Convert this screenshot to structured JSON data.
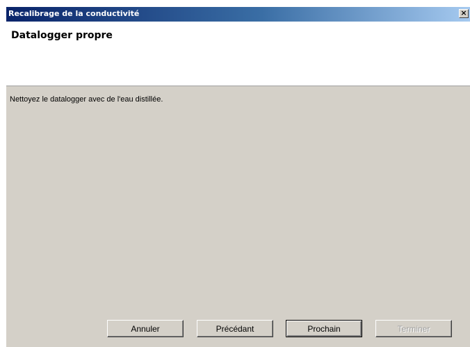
{
  "window": {
    "title": "Recalibrage de la conductivité",
    "close_label": "×"
  },
  "header": {
    "title": "Datalogger propre"
  },
  "body": {
    "instruction": "Nettoyez le datalogger avec de l'eau distillée."
  },
  "buttons": {
    "cancel": "Annuler",
    "previous": "Précédant",
    "next": "Prochain",
    "finish": "Terminer",
    "finish_enabled": false
  },
  "colors": {
    "titlebar_start": "#0a246a",
    "titlebar_end": "#a6caf0",
    "dialog_face": "#d4d0c8",
    "header_background": "#ffffff"
  }
}
